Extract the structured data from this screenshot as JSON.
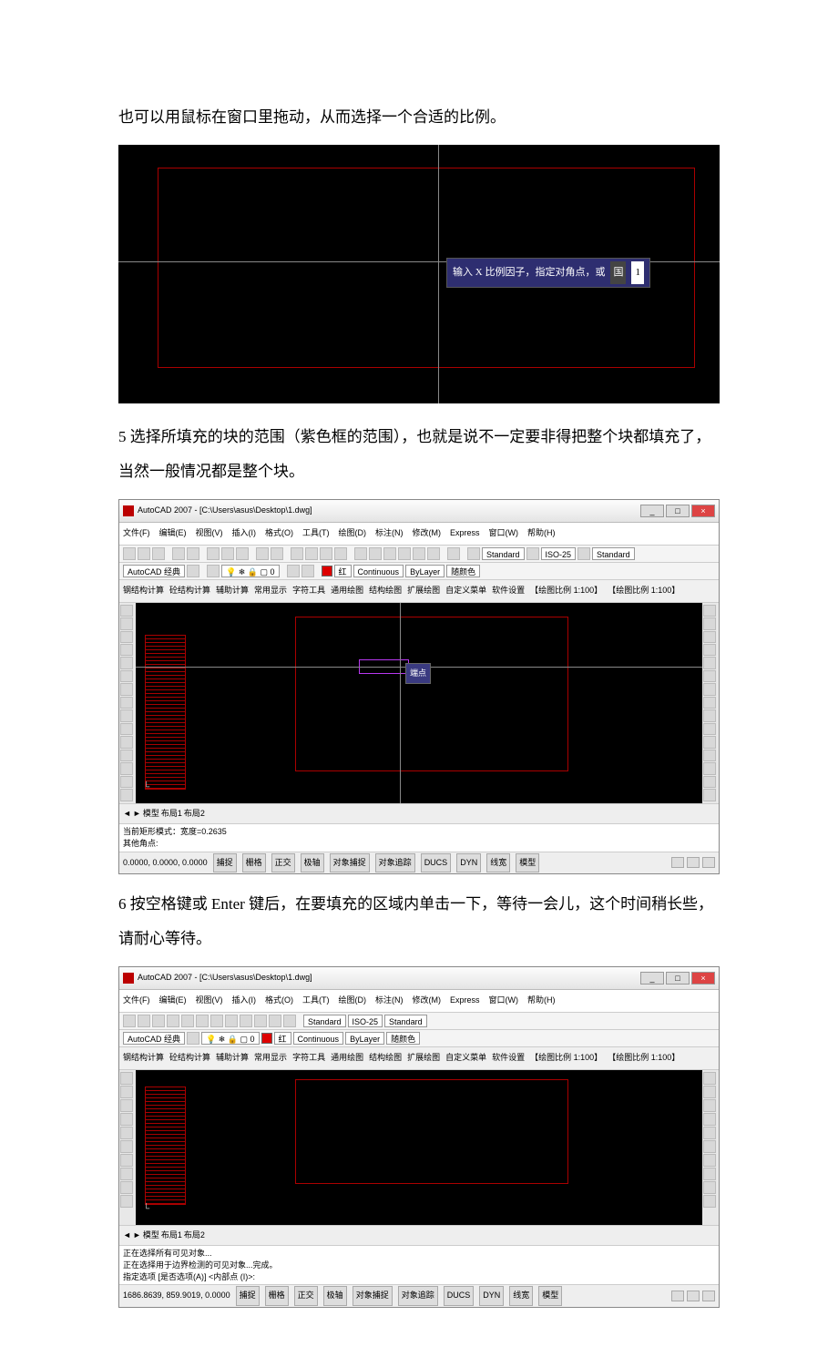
{
  "para1": "也可以用鼠标在窗口里拖动，从而选择一个合适的比例。",
  "para2": "5 选择所填充的块的范围（紫色框的范围），也就是说不一定要非得把整个块都填充了，当然一般情况都是整个块。",
  "para3": "6 按空格键或 Enter 键后，在要填充的区域内单击一下，等待一会儿，这个时间稍长些，请耐心等待。",
  "prompt1": {
    "text": "输入 X 比例因子，指定对角点，或",
    "icon": "国",
    "value": "1"
  },
  "acad": {
    "title": "AutoCAD 2007 - [C:\\Users\\asus\\Desktop\\1.dwg]",
    "menus": [
      "文件(F)",
      "编辑(E)",
      "视图(V)",
      "插入(I)",
      "格式(O)",
      "工具(T)",
      "绘图(D)",
      "标注(N)",
      "修改(M)",
      "Express",
      "窗口(W)",
      "帮助(H)"
    ],
    "workspace_label": "AutoCAD 经典",
    "style_combo": "Standard",
    "dim_combo": "ISO-25",
    "table_combo": "Standard",
    "layer_color": "红",
    "line_combo1": "Continuous",
    "line_combo2": "ByLayer",
    "line_combo3": "随颜色",
    "custom_tabs": [
      "钢结构计算",
      "砼结构计算",
      "辅助计算",
      "常用显示",
      "字符工具",
      "通用绘图",
      "结构绘图",
      "扩展绘图",
      "自定义菜单",
      "软件设置",
      "【绘图比例 1:100】",
      "【绘图比例 1:100】"
    ],
    "tooltip2": "端点",
    "ucs": "└",
    "model_tabs": [
      "模型",
      "布局1",
      "布局2"
    ],
    "cmd1_line1": "当前矩形模式：宽度=0.2635",
    "cmd1_line2": "其他角点:",
    "cmd2_line1": "正在选择所有可见对象...",
    "cmd2_line2": "正在选择用于边界检测的可见对象...完成。",
    "cmd2_line3": "指定选项 [是否选项(A)] <内部点 (I)>:",
    "coords1": "0.0000, 0.0000, 0.0000",
    "coords2": "1686.8639,  859.9019,  0.0000",
    "status_buttons": [
      "捕捉",
      "栅格",
      "正交",
      "极轴",
      "对象捕捉",
      "对象追踪",
      "DUCS",
      "DYN",
      "线宽",
      "模型"
    ]
  }
}
